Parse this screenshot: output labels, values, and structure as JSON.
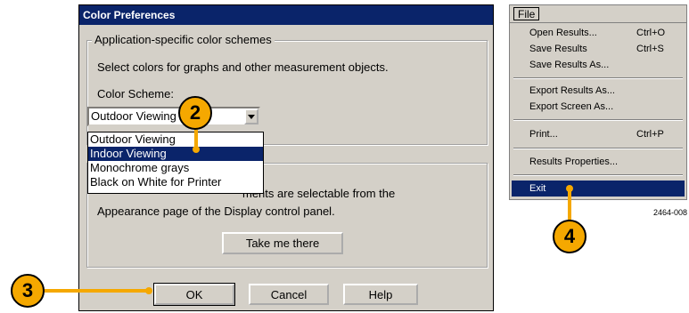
{
  "dialog": {
    "title": "Color Preferences",
    "group1_legend": "Application-specific color schemes",
    "description": "Select colors for graphs and other measurement objects.",
    "color_scheme_label": "Color Scheme:",
    "combo_value": "Outdoor Viewing",
    "options": [
      "Outdoor Viewing",
      "Indoor Viewing",
      "Monochrome grays",
      "Black on White for Printer"
    ],
    "selected_option": "Indoor Viewing",
    "group2_text_line1": "ments are selectable from the",
    "group2_text_line2": "Appearance page of the Display control panel.",
    "take_me_there": "Take me there",
    "ok": "OK",
    "cancel": "Cancel",
    "help": "Help"
  },
  "menu": {
    "title": "File",
    "items": [
      {
        "label": "Open Results...",
        "shortcut": "Ctrl+O"
      },
      {
        "label": "Save Results",
        "shortcut": "Ctrl+S"
      },
      {
        "label": "Save Results As...",
        "shortcut": ""
      },
      {
        "label": "Export Results As...",
        "shortcut": ""
      },
      {
        "label": "Export Screen As...",
        "shortcut": ""
      },
      {
        "label": "Print...",
        "shortcut": "Ctrl+P"
      },
      {
        "label": "Results Properties...",
        "shortcut": ""
      },
      {
        "label": "Exit",
        "shortcut": ""
      }
    ],
    "figure_id": "2464-008"
  },
  "callouts": {
    "c2": "2",
    "c3": "3",
    "c4": "4"
  },
  "colors": {
    "title_bar": "#0a246a",
    "selection": "#0a246a",
    "callout": "#f5a800",
    "dialog_bg": "#d4d0c8"
  }
}
